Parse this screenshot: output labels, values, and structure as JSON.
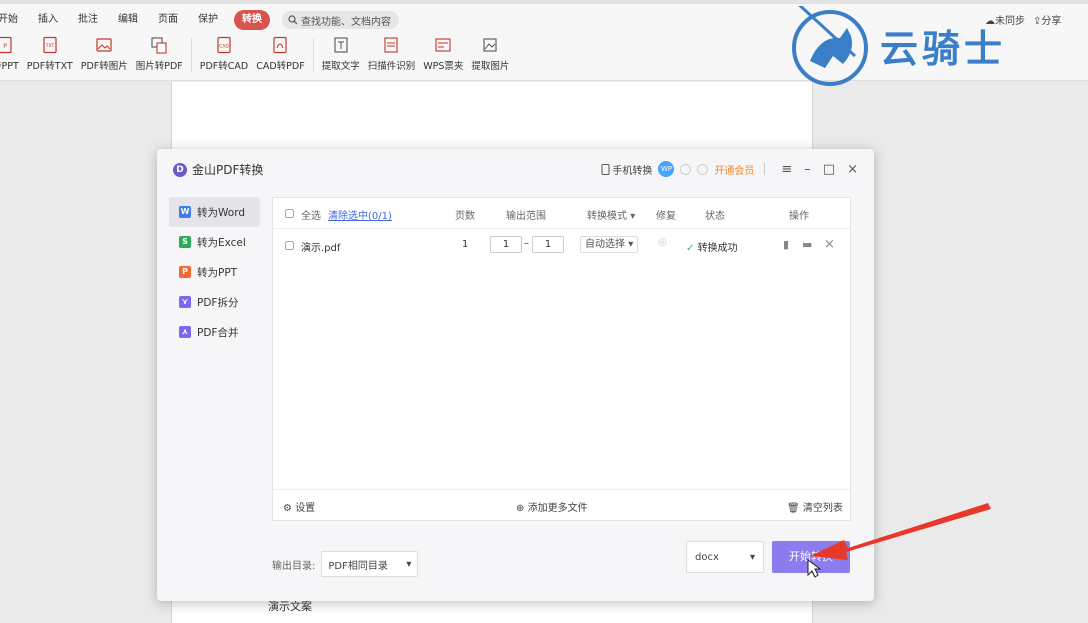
{
  "ribbon": {
    "menu": [
      "开始",
      "插入",
      "批注",
      "编辑",
      "页面",
      "保护",
      "转换"
    ],
    "active_menu": "转换",
    "search_placeholder": "查找功能、文档内容",
    "right": {
      "sync": "未同步",
      "share": "分享"
    },
    "tools": [
      "转PPT",
      "PDF转TXT",
      "PDF转图片",
      "图片转PDF",
      "PDF转CAD",
      "CAD转PDF",
      "提取文字",
      "扫描件识别",
      "WPS票夹",
      "提取图片"
    ]
  },
  "watermark": {
    "text": "云骑士"
  },
  "document": {
    "line": "演示文案"
  },
  "dialog": {
    "title": "金山PDF转换",
    "mobile": "手机转换",
    "avatar": "WP",
    "vip": "开通会员",
    "controls": {
      "menu": "≡",
      "minimize": "–",
      "maximize": "□",
      "close": "×"
    },
    "sidebar": [
      {
        "label": "转为Word",
        "icon": "W",
        "color": "#3b7ded"
      },
      {
        "label": "转为Excel",
        "icon": "S",
        "color": "#2eaa5c"
      },
      {
        "label": "转为PPT",
        "icon": "P",
        "color": "#f06a35"
      },
      {
        "label": "PDF拆分",
        "icon": "⋎",
        "color": "#7b68ee"
      },
      {
        "label": "PDF合并",
        "icon": "⋏",
        "color": "#7b68ee"
      }
    ],
    "table": {
      "select_all": "全选",
      "clear_selected": "清除选中(0/1)",
      "headers": {
        "pages": "页数",
        "range": "输出范围",
        "mode": "转换模式",
        "repair": "修复",
        "status": "状态",
        "actions": "操作"
      },
      "rows": [
        {
          "file": "演示.pdf",
          "pages": "1",
          "range_from": "1",
          "range_to": "1",
          "mode": "自动选择",
          "status": "转换成功"
        }
      ]
    },
    "footer": {
      "settings": "设置",
      "add_files": "添加更多文件",
      "clear_list": "清空列表"
    },
    "output": {
      "label": "输出目录:",
      "value": "PDF相同目录"
    },
    "format": "docx",
    "start": "开始转换"
  }
}
